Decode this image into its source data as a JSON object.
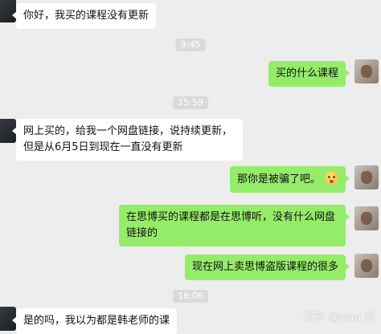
{
  "messages": [
    {
      "side": "in",
      "text": "你好，我买的课程没有更新"
    },
    {
      "side": "out",
      "text": "买的什么课程"
    },
    {
      "side": "in",
      "text": "网上买的，给我一个网盘链接，说持续更新，但是从6月5日到现在一直没有更新"
    },
    {
      "side": "out",
      "text": "那你是被骗了吧。"
    },
    {
      "side": "out",
      "text": "在思博买的课程都是在思博听，没有什么网盘链接的"
    },
    {
      "side": "out",
      "text": "现在网上卖思博盗版课程的很多"
    },
    {
      "side": "in",
      "text": "是的吗，我以为都是韩老师的课"
    }
  ],
  "timestamps": [
    "9:45",
    "15:59",
    "16:06"
  ],
  "emoji": "worried-face-icon",
  "watermark": "知乎 @xiao 柒"
}
